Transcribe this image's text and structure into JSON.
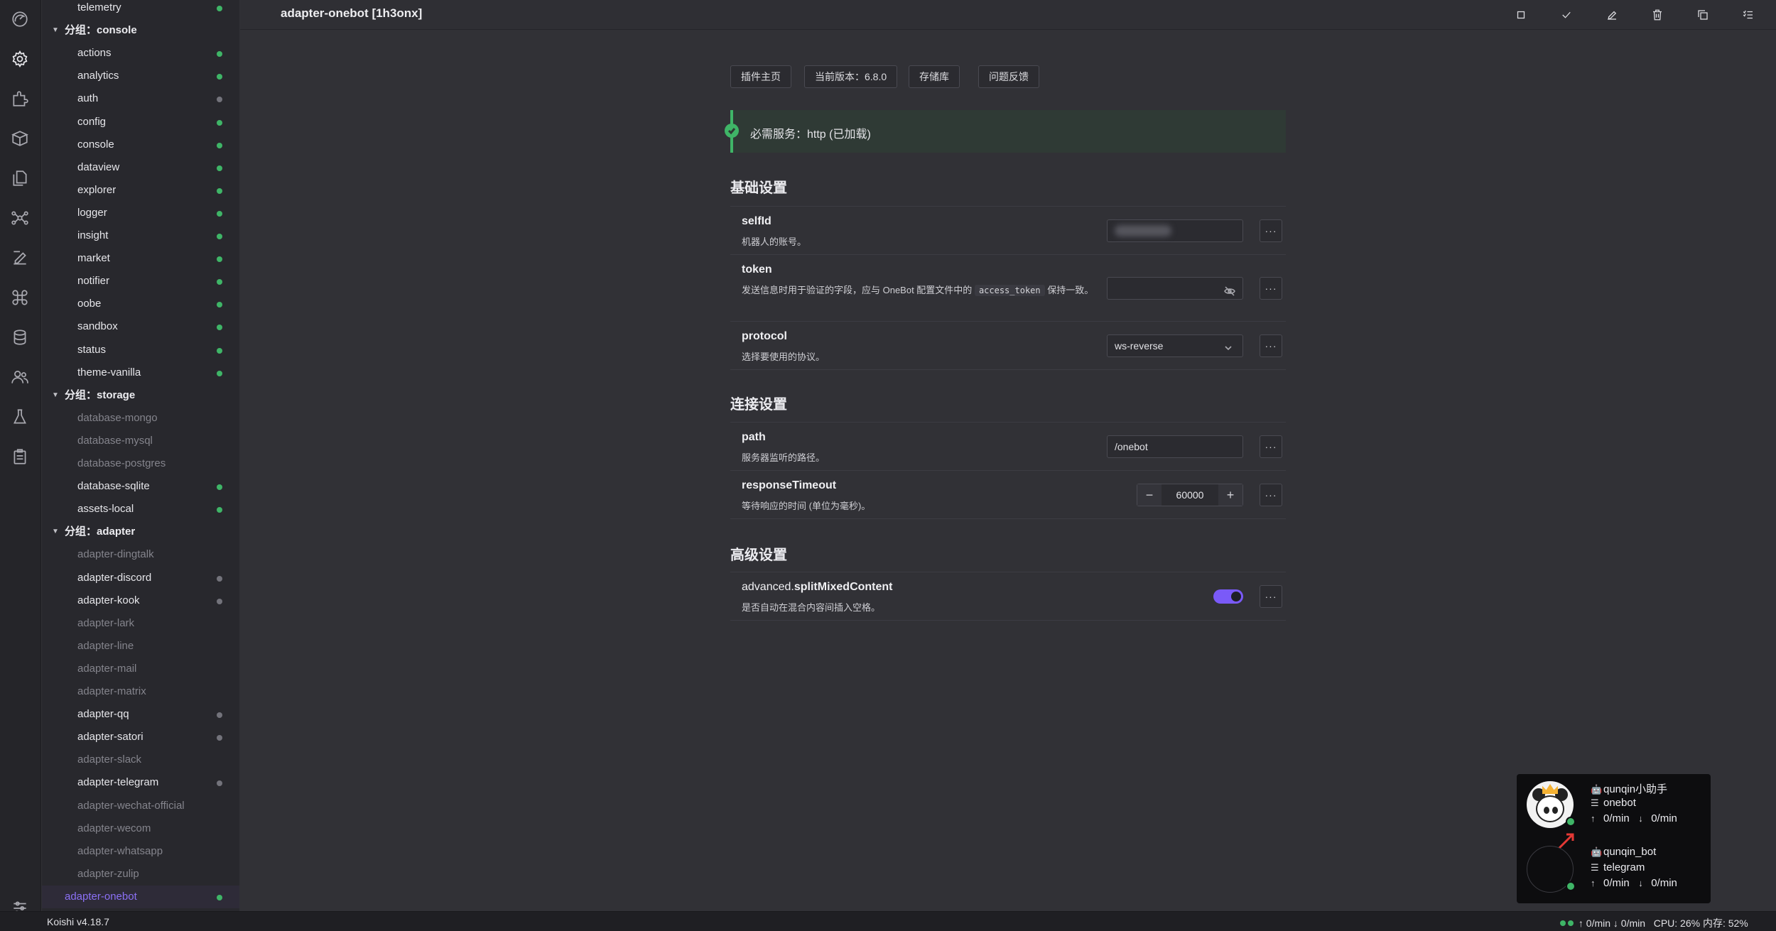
{
  "header": {
    "title": "adapter-onebot [1h3onx]"
  },
  "activity_icons": [
    "dashboard-icon",
    "settings-icon",
    "plugins-icon",
    "market-icon",
    "files-icon",
    "network-icon",
    "edit-icon",
    "command-icon",
    "database-icon",
    "users-icon",
    "lab-icon",
    "clipboard-icon",
    "preferences-icon"
  ],
  "sidebar": {
    "rows": [
      {
        "label": "telemetry",
        "kind": "normal",
        "dot": "green"
      },
      {
        "label": "分组：console",
        "kind": "group"
      },
      {
        "label": "actions",
        "kind": "normal",
        "dot": "green"
      },
      {
        "label": "analytics",
        "kind": "normal",
        "dot": "green"
      },
      {
        "label": "auth",
        "kind": "normal",
        "dot": "grey"
      },
      {
        "label": "config",
        "kind": "normal",
        "dot": "green"
      },
      {
        "label": "console",
        "kind": "normal",
        "dot": "green"
      },
      {
        "label": "dataview",
        "kind": "normal",
        "dot": "green"
      },
      {
        "label": "explorer",
        "kind": "normal",
        "dot": "green"
      },
      {
        "label": "logger",
        "kind": "normal",
        "dot": "green"
      },
      {
        "label": "insight",
        "kind": "normal",
        "dot": "green"
      },
      {
        "label": "market",
        "kind": "normal",
        "dot": "green"
      },
      {
        "label": "notifier",
        "kind": "normal",
        "dot": "green"
      },
      {
        "label": "oobe",
        "kind": "normal",
        "dot": "green"
      },
      {
        "label": "sandbox",
        "kind": "normal",
        "dot": "green"
      },
      {
        "label": "status",
        "kind": "normal",
        "dot": "green"
      },
      {
        "label": "theme-vanilla",
        "kind": "normal",
        "dot": "green"
      },
      {
        "label": "分组：storage",
        "kind": "group"
      },
      {
        "label": "database-mongo",
        "kind": "disabled"
      },
      {
        "label": "database-mysql",
        "kind": "disabled"
      },
      {
        "label": "database-postgres",
        "kind": "disabled"
      },
      {
        "label": "database-sqlite",
        "kind": "normal",
        "dot": "green"
      },
      {
        "label": "assets-local",
        "kind": "normal",
        "dot": "green"
      },
      {
        "label": "分组：adapter",
        "kind": "group"
      },
      {
        "label": "adapter-dingtalk",
        "kind": "disabled"
      },
      {
        "label": "adapter-discord",
        "kind": "normal",
        "dot": "grey"
      },
      {
        "label": "adapter-kook",
        "kind": "normal",
        "dot": "grey"
      },
      {
        "label": "adapter-lark",
        "kind": "disabled"
      },
      {
        "label": "adapter-line",
        "kind": "disabled"
      },
      {
        "label": "adapter-mail",
        "kind": "disabled"
      },
      {
        "label": "adapter-matrix",
        "kind": "disabled"
      },
      {
        "label": "adapter-qq",
        "kind": "normal",
        "dot": "grey"
      },
      {
        "label": "adapter-satori",
        "kind": "normal",
        "dot": "grey"
      },
      {
        "label": "adapter-slack",
        "kind": "disabled"
      },
      {
        "label": "adapter-telegram",
        "kind": "normal",
        "dot": "grey"
      },
      {
        "label": "adapter-wechat-official",
        "kind": "disabled"
      },
      {
        "label": "adapter-wecom",
        "kind": "disabled"
      },
      {
        "label": "adapter-whatsapp",
        "kind": "disabled"
      },
      {
        "label": "adapter-zulip",
        "kind": "disabled"
      },
      {
        "label": "adapter-onebot",
        "kind": "active",
        "dot": "green"
      }
    ]
  },
  "links": {
    "homepage": "插件主页",
    "version": "当前版本：6.8.0",
    "repo": "存储库",
    "issues": "问题反馈"
  },
  "notice": "必需服务：http (已加载)",
  "sections": {
    "basic": "基础设置",
    "connection": "连接设置",
    "advanced": "高级设置"
  },
  "fields": {
    "selfId": {
      "name": "selfId",
      "desc": "机器人的账号。"
    },
    "token": {
      "name": "token",
      "desc_before": "发送信息时用于验证的字段，应与 OneBot 配置文件中的",
      "code": "access_token",
      "desc_after": "保持一致。"
    },
    "protocol": {
      "name": "protocol",
      "desc": "选择要使用的协议。",
      "value": "ws-reverse"
    },
    "path": {
      "name": "path",
      "desc": "服务器监听的路径。",
      "value": "/onebot"
    },
    "responseTimeout": {
      "name": "responseTimeout",
      "desc": "等待响应的时间 (单位为毫秒)。",
      "value": "60000"
    },
    "splitMixedContent": {
      "prefix": "advanced.",
      "name": "splitMixedContent",
      "desc": "是否自动在混合内容间插入空格。",
      "enabled": true
    }
  },
  "more_label": "···",
  "bots": [
    {
      "name": "qunqin小助手",
      "platform": "onebot",
      "up": "0/min",
      "down": "0/min"
    },
    {
      "name": "qunqin_bot",
      "platform": "telegram",
      "up": "0/min",
      "down": "0/min"
    }
  ],
  "statusbar": {
    "version": "Koishi v4.18.7",
    "traffic": "↑ 0/min ↓ 0/min",
    "cpu": "CPU: 26% 内存: 52%"
  },
  "colors": {
    "accent": "#7a5af8",
    "success": "#3fb567"
  }
}
